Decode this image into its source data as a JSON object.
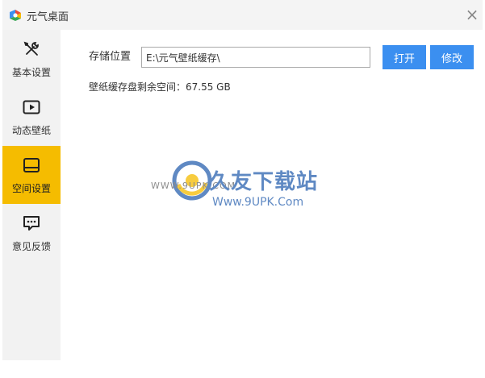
{
  "window": {
    "title": "元气桌面",
    "close_glyph": "×"
  },
  "sidebar": {
    "items": [
      {
        "label": "基本设置",
        "icon": "tools-icon",
        "active": false
      },
      {
        "label": "动态壁纸",
        "icon": "play-icon",
        "active": false
      },
      {
        "label": "空间设置",
        "icon": "storage-icon",
        "active": true
      },
      {
        "label": "意见反馈",
        "icon": "chat-icon",
        "active": false
      }
    ]
  },
  "storage": {
    "label": "存储位置",
    "path_value": "E:\\元气壁纸缓存\\",
    "open_label": "打开",
    "modify_label": "修改",
    "free_space_text": "壁纸缓存盘剩余空间：67.55 GB"
  },
  "watermark": {
    "site_small": "WWW.9UPK.COM",
    "site_name": "久友下载站",
    "site_url": "Www.9UPK.Com"
  },
  "colors": {
    "accent": "#f5bc00",
    "button": "#3b8ff0",
    "sidebar_bg": "#f2f2f2",
    "titlebar_bg": "#f4f4f4"
  }
}
